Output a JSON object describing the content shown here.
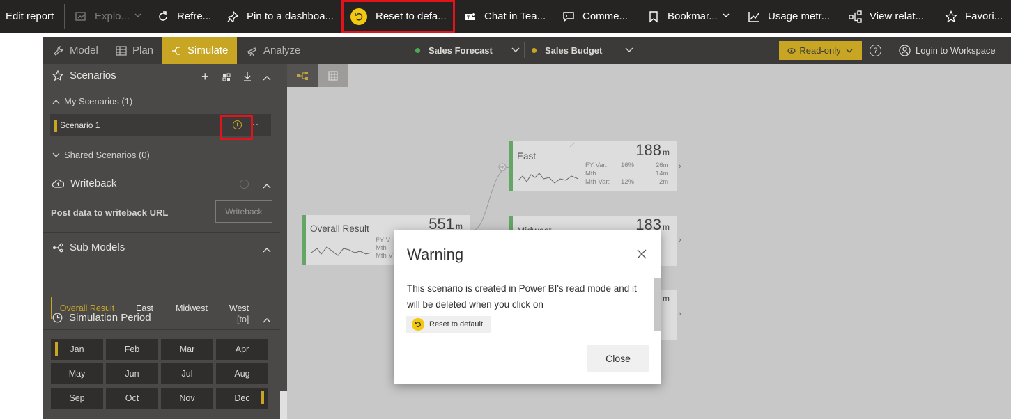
{
  "topbar": {
    "edit_report": "Edit report",
    "explore": "Explo...",
    "refresh": "Refre...",
    "pin": "Pin to a dashboa...",
    "reset": "Reset to defa...",
    "chat": "Chat in Tea...",
    "comments": "Comme...",
    "bookmarks": "Bookmar...",
    "usage": "Usage metr...",
    "view_related": "View relat...",
    "favorites": "Favori..."
  },
  "appbar": {
    "tabs": [
      "Model",
      "Plan",
      "Simulate",
      "Analyze"
    ],
    "forecast": "Sales Forecast",
    "budget": "Sales Budget",
    "readonly": "Read-only",
    "login": "Login to Workspace"
  },
  "left": {
    "scenarios_title": "Scenarios",
    "my_scenarios": "My Scenarios (1)",
    "scenario_name": "Scenario 1",
    "shared_scenarios": "Shared Scenarios (0)",
    "writeback_title": "Writeback",
    "writeback_label": "Post data to writeback URL",
    "writeback_button": "Writeback",
    "submodels_title": "Sub Models",
    "submodels": [
      "Overall Result",
      "East",
      "Midwest",
      "West"
    ],
    "period_title": "Simulation Period",
    "period_badge": "[to]",
    "months": [
      "Jan",
      "Feb",
      "Mar",
      "Apr",
      "May",
      "Jun",
      "Jul",
      "Aug",
      "Sep",
      "Oct",
      "Nov",
      "Dec"
    ]
  },
  "nodes": {
    "overall": {
      "name": "Overall Result",
      "value": "551",
      "unit": "m",
      "fy": "FY V",
      "mth": "Mth",
      "mthv": "Mth V"
    },
    "east": {
      "name": "East",
      "value": "188",
      "unit": "m",
      "fy_label": "FY Var:",
      "fy_pct": "16%",
      "fy_val": "26m",
      "mth_label": "Mth",
      "mth_val": "14m",
      "mthv_label": "Mth Var:",
      "mthv_pct": "12%",
      "mthv_val": "2m"
    },
    "midwest": {
      "name": "Midwest",
      "value": "183",
      "unit": "m"
    },
    "third": {
      "unit": "m"
    }
  },
  "dialog": {
    "title": "Warning",
    "body": "This scenario is created in Power BI's read mode and it will be deleted when you click on",
    "chip": "Reset to default",
    "close": "Close"
  },
  "colors": {
    "accent": "#c8a623",
    "topbar": "#252423",
    "node_bar": "#4fa853",
    "highlight": "#e3131b",
    "reset_icon": "#f2c811"
  }
}
